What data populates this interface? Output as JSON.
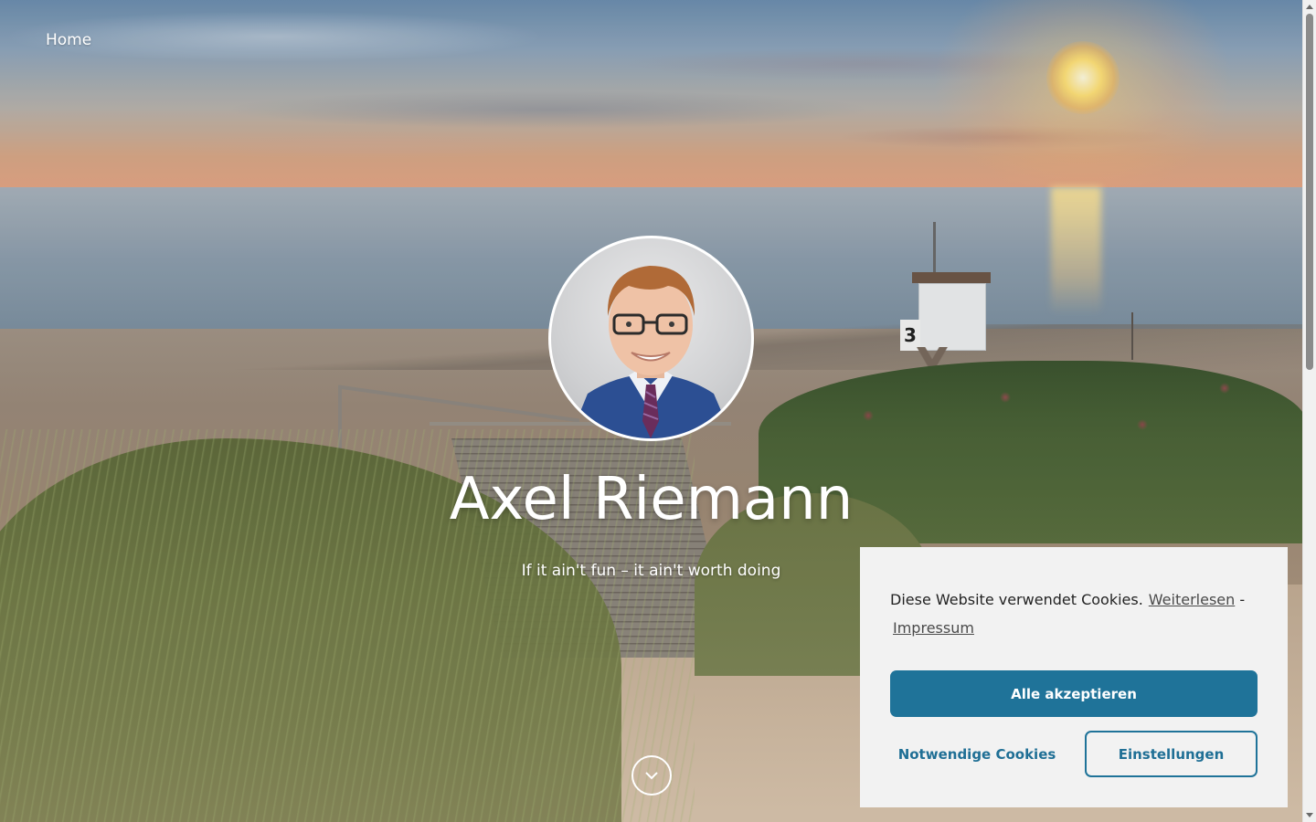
{
  "nav": {
    "home_label": "Home"
  },
  "hero": {
    "name": "Axel Riemann",
    "tagline": "If it ain't fun – it ain't worth doing",
    "scroll_icon": "chevron-down-icon",
    "tower_number": "3"
  },
  "cookie_banner": {
    "message": "Diese Website verwendet Cookies.",
    "read_more_label": "Weiterlesen",
    "separator": "-",
    "imprint_label": "Impressum",
    "accept_all_label": "Alle akzeptieren",
    "necessary_label": "Notwendige Cookies",
    "settings_label": "Einstellungen"
  },
  "colors": {
    "accent": "#1f7399",
    "banner_bg": "#f2f2f2",
    "hero_text": "#ffffff"
  }
}
